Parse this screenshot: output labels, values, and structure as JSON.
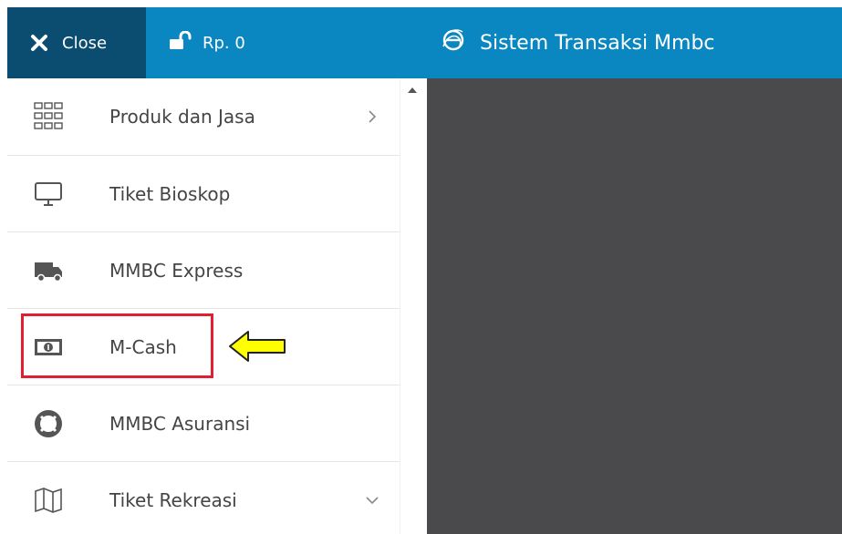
{
  "header": {
    "close_label": "Close",
    "balance": "Rp. 0",
    "title": "Sistem Transaksi Mmbc",
    "bg_color": "#0a86c0",
    "close_bg_color": "#0a4d71"
  },
  "sidebar": {
    "items": [
      {
        "label": "Produk dan Jasa",
        "icon": "grid-icon",
        "chevron": "right"
      },
      {
        "label": "Tiket Bioskop",
        "icon": "monitor-icon"
      },
      {
        "label": "MMBC Express",
        "icon": "truck-icon"
      },
      {
        "label": "M-Cash",
        "icon": "money-icon"
      },
      {
        "label": "MMBC Asuransi",
        "icon": "lifebuoy-icon"
      },
      {
        "label": "Tiket Rekreasi",
        "icon": "map-icon",
        "chevron": "down"
      }
    ]
  },
  "annotation": {
    "highlight_color": "#e02030",
    "arrow_color": "#ffff00"
  },
  "content": {
    "bg_color": "#4a4a4c"
  }
}
